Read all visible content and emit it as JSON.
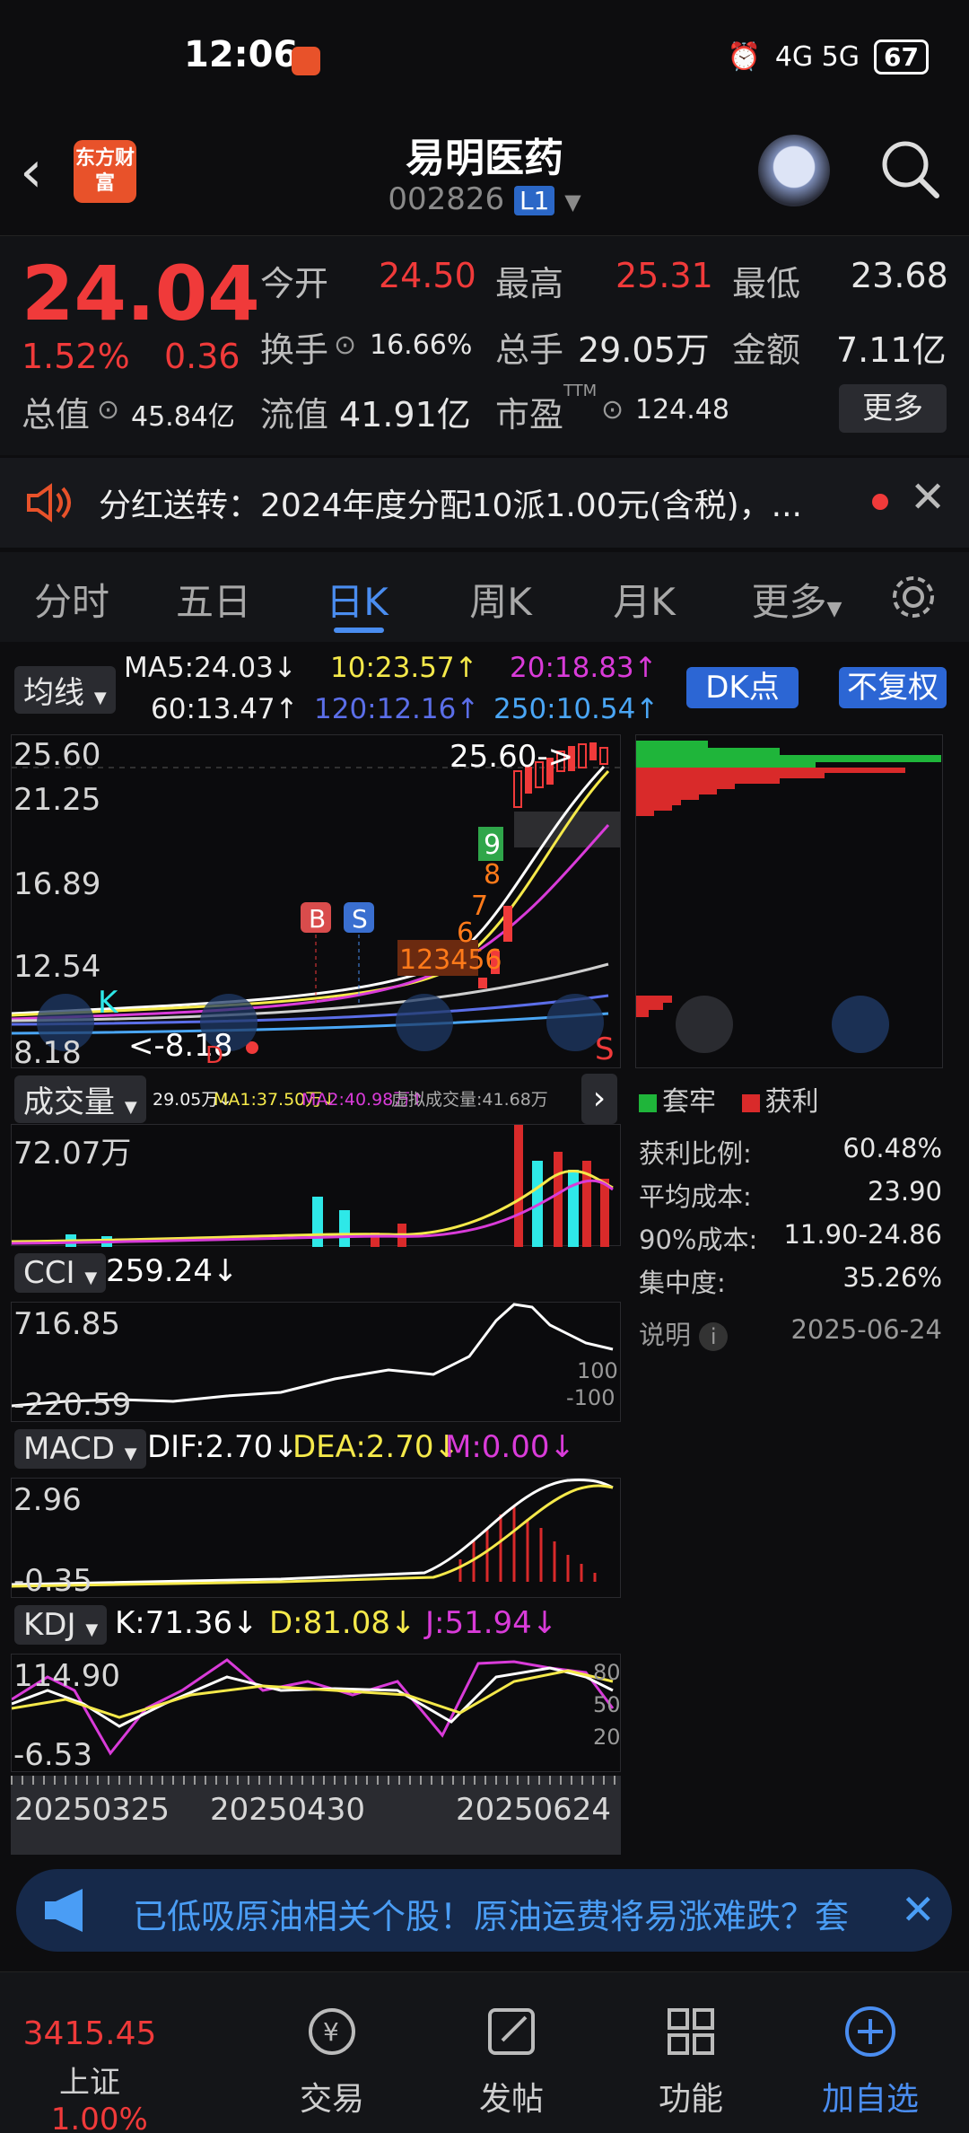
{
  "status": {
    "time": "12:06",
    "signal": "4G 5G",
    "battery": "67"
  },
  "header": {
    "title": "易明医药",
    "code": "002826",
    "level": "L1",
    "logo_text": "东方财富"
  },
  "quote": {
    "price": "24.04",
    "pct": "1.52%",
    "change": "0.36",
    "open_label": "今开",
    "open": "24.50",
    "high_label": "最高",
    "high": "25.31",
    "low_label": "最低",
    "low": "23.68",
    "turnover_label": "换手",
    "turnover": "16.66%",
    "volume_label": "总手",
    "volume": "29.05万",
    "amount_label": "金额",
    "amount": "7.11亿",
    "mktcap_label": "总值",
    "mktcap": "45.84亿",
    "float_label": "流值",
    "float": "41.91亿",
    "pe_label": "市盈",
    "pe_sup": "TTM",
    "pe": "124.48",
    "more": "更多"
  },
  "notice": {
    "text": "分红送转：2024年度分配10派1.00元(含税)，..."
  },
  "tabs": [
    "分时",
    "五日",
    "日K",
    "周K",
    "月K",
    "更多"
  ],
  "ma": {
    "chip": "均线",
    "ma5": "MA5:24.03↓",
    "ma10": "10:23.57↑",
    "ma20": "20:18.83↑",
    "ma60": "60:13.47↑",
    "ma120": "120:12.16↑",
    "ma250": "250:10.54↑",
    "dk": "DK点",
    "fq": "不复权"
  },
  "main_chart": {
    "ticks": [
      "25.60",
      "21.25",
      "16.89",
      "12.54",
      "8.18"
    ],
    "high_marker": "25.60->",
    "low_marker": "<-8.18",
    "b_label": "B",
    "s_label": "S",
    "k_label": "K",
    "d_label": "D",
    "s2_label": "S",
    "seq_labels": [
      "1",
      "2",
      "3",
      "4",
      "5",
      "6",
      "7",
      "8",
      "9"
    ]
  },
  "volume": {
    "chip": "成交量",
    "v": "29.05万↓",
    "ma1": "MA1:37.50万↓",
    "ma2": "MA2:40.98万↑",
    "virtual": "虚拟成交量:41.68万",
    "tick": "72.07万"
  },
  "cci": {
    "chip": "CCI",
    "value": "259.24↓",
    "tick_top": "716.85",
    "tick_bottom": "-220.59",
    "ref_top": "100",
    "ref_bottom": "-100"
  },
  "macd": {
    "chip": "MACD",
    "dif": "DIF:2.70↓",
    "dea": "DEA:2.70↓",
    "m": "M:0.00↓",
    "tick_top": "2.96",
    "tick_bottom": "-0.35"
  },
  "kdj": {
    "chip": "KDJ",
    "k": "K:71.36↓",
    "d": "D:81.08↓",
    "j": "J:51.94↓",
    "tick_top": "114.90",
    "tick_bottom": "-6.53",
    "ref": [
      "80",
      "50",
      "20"
    ]
  },
  "dates": [
    "20250325",
    "20250430",
    "20250624"
  ],
  "dist": {
    "legend_trapped": "套牢",
    "legend_profit": "获利",
    "stats": [
      {
        "label": "获利比例:",
        "value": "60.48%"
      },
      {
        "label": "平均成本:",
        "value": "23.90"
      },
      {
        "label": "90%成本:",
        "value": "11.90-24.86"
      },
      {
        "label": "集中度:",
        "value": "35.26%"
      }
    ],
    "note_label": "说明",
    "date": "2025-06-24"
  },
  "ad": {
    "text": "已低吸原油相关个股！原油运费将易涨难跌？套"
  },
  "bottom": {
    "index_value": "3415.45",
    "index_name": "上证",
    "index_pct": "1.00%",
    "nav": [
      "交易",
      "发帖",
      "功能",
      "加自选"
    ]
  },
  "colors": {
    "up": "#f03a3a",
    "accent": "#4a8df0",
    "ma10": "#f5e94a",
    "ma20": "#d93bd9",
    "ma120": "#5b6ee8",
    "ma250": "#4aa6f5"
  }
}
